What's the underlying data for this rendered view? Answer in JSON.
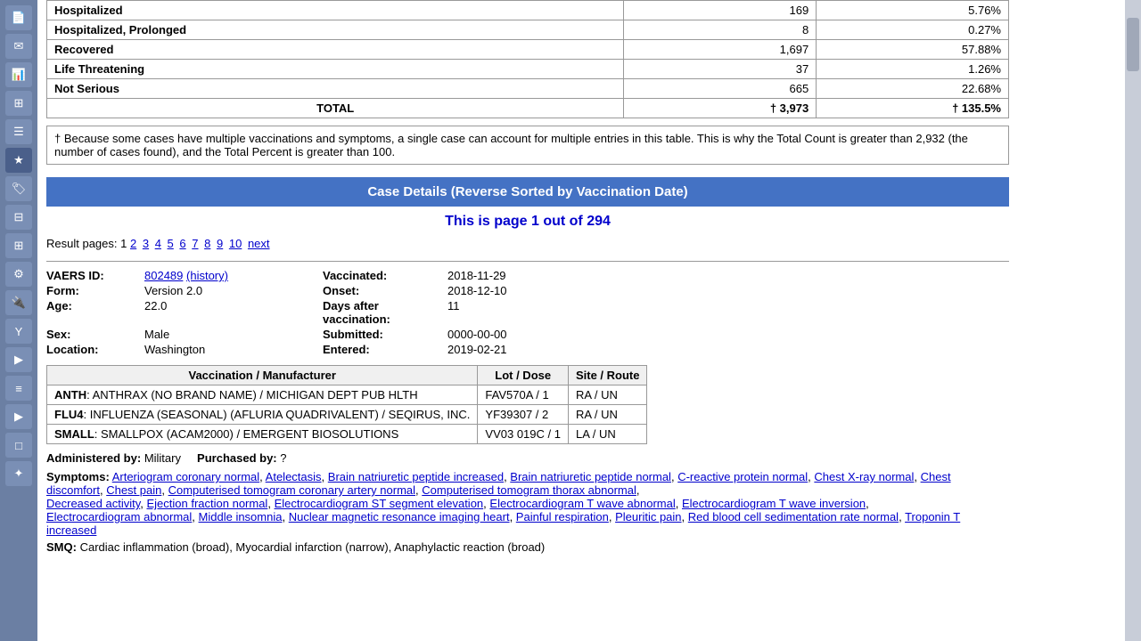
{
  "sidebar": {
    "icons": [
      {
        "name": "page-icon",
        "symbol": "📄"
      },
      {
        "name": "mail-icon",
        "symbol": "✉"
      },
      {
        "name": "chart-icon",
        "symbol": "📊"
      },
      {
        "name": "grid-icon",
        "symbol": "⊞"
      },
      {
        "name": "list-icon",
        "symbol": "☰"
      },
      {
        "name": "star-active-icon",
        "symbol": "★"
      },
      {
        "name": "tag-icon",
        "symbol": "🏷"
      },
      {
        "name": "layers-icon",
        "symbol": "⊟"
      },
      {
        "name": "apps-icon",
        "symbol": "⊞"
      },
      {
        "name": "settings-icon",
        "symbol": "⚙"
      },
      {
        "name": "plugin-icon",
        "symbol": "🔌"
      },
      {
        "name": "y-icon",
        "symbol": "Y"
      },
      {
        "name": "play-icon",
        "symbol": "▶"
      },
      {
        "name": "filter-icon",
        "symbol": "≡"
      },
      {
        "name": "play2-icon",
        "symbol": "▶"
      },
      {
        "name": "box-icon",
        "symbol": "□"
      },
      {
        "name": "puzzle-icon",
        "symbol": "✦"
      }
    ]
  },
  "summary_table": {
    "rows": [
      {
        "label": "Hospitalized",
        "count": "169",
        "pct": "5.76%"
      },
      {
        "label": "Hospitalized, Prolonged",
        "count": "8",
        "pct": "0.27%"
      },
      {
        "label": "Recovered",
        "count": "1,697",
        "pct": "57.88%"
      },
      {
        "label": "Life Threatening",
        "count": "37",
        "pct": "1.26%"
      },
      {
        "label": "Not Serious",
        "count": "665",
        "pct": "22.68%"
      }
    ],
    "total_label": "TOTAL",
    "total_count": "† 3,973",
    "total_pct": "† 135.5%",
    "footnote": "† Because some cases have multiple vaccinations and symptoms, a single case can account for multiple entries in this table. This is why the Total Count is greater than 2,932 (the number of cases found), and the Total Percent is greater than 100."
  },
  "section_header": "Case Details (Reverse Sorted by Vaccination Date)",
  "page_info": "This is page 1 out of 294",
  "pagination": {
    "prefix": "Result pages:  1",
    "links": [
      "2",
      "3",
      "4",
      "5",
      "6",
      "7",
      "8",
      "9",
      "10"
    ],
    "next_label": "next"
  },
  "case": {
    "vaers_id": "802489",
    "vaers_id_link": "#",
    "history_label": "(history)",
    "history_link": "#",
    "vaccinated_label": "Vaccinated:",
    "vaccinated_value": "2018-11-29",
    "form_label": "Form:",
    "form_value": "Version 2.0",
    "onset_label": "Onset:",
    "onset_value": "2018-12-10",
    "age_label": "Age:",
    "age_value": "22.0",
    "days_label": "Days after vaccination:",
    "days_value": "11",
    "sex_label": "Sex:",
    "sex_value": "Male",
    "submitted_label": "Submitted:",
    "submitted_value": "0000-00-00",
    "location_label": "Location:",
    "location_value": "Washington",
    "entered_label": "Entered:",
    "entered_value": "2019-02-21",
    "vaccinations": [
      {
        "type": "ANTH",
        "description": "ANTHRAX (NO BRAND NAME) / MICHIGAN DEPT PUB HLTH",
        "lot": "FAV570A / 1",
        "site_route": "RA / UN"
      },
      {
        "type": "FLU4",
        "description": "INFLUENZA (SEASONAL) (AFLURIA QUADRIVALENT) / SEQIRUS, INC.",
        "lot": "YF39307 / 2",
        "site_route": "RA / UN"
      },
      {
        "type": "SMALL",
        "description": "SMALLPOX (ACAM2000) / EMERGENT BIOSOLUTIONS",
        "lot": "VV03 019C / 1",
        "site_route": "LA / UN"
      }
    ],
    "vax_table_headers": [
      "Vaccination / Manufacturer",
      "Lot / Dose",
      "Site / Route"
    ],
    "administered_label": "Administered by:",
    "administered_value": "Military",
    "purchased_label": "Purchased by:",
    "purchased_value": "?",
    "symptoms_label": "Symptoms:",
    "symptoms": [
      "Arteriogram coronary normal",
      "Atelectasis",
      "Brain natriuretic peptide increased",
      "Brain natriuretic peptide normal",
      "C-reactive protein normal",
      "Chest X-ray normal",
      "Chest discomfort",
      "Chest pain",
      "Computerised tomogram coronary artery normal",
      "Computerised tomogram thorax abnormal",
      "Decreased activity",
      "Ejection fraction normal",
      "Electrocardiogram ST segment elevation",
      "Electrocardiogram T wave abnormal",
      "Electrocardiogram T wave inversion",
      "Electrocardiogram abnormal",
      "Middle insomnia",
      "Nuclear magnetic resonance imaging heart",
      "Painful respiration",
      "Pleuritic pain",
      "Red blood cell sedimentation rate normal",
      "Troponin T increased"
    ],
    "smq_label": "SMQ:",
    "smq_partial": "Cardiac inflammation (broad), Myocardial infarction (narrow), Anaphylactic reaction (broad)"
  }
}
